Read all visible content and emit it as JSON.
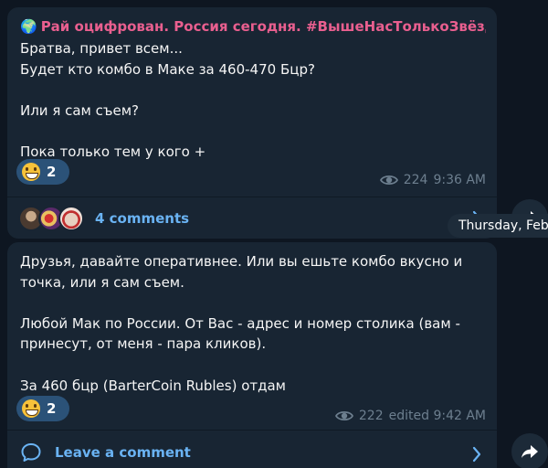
{
  "post1": {
    "channel_emoji": "🌍",
    "channel_name": "Рай оцифрован. Россия сегодня. #ВышеНасТолькоЗвёзд...",
    "text": "Братва, привет всем...\nБудет кто комбо в Маке за 460-470 Бцр?\n\nИли я сам съем?\n\nПока только тем у кого +",
    "reaction_count": "2",
    "views": "224",
    "time": "9:36 AM",
    "comments_label": "4 comments"
  },
  "date_chip": "Thursday, Feb",
  "post2": {
    "text": "Друзья, давайте оперативнее. Или вы ешьте комбо вкусно и точка, или я сам съем.\n\nЛюбой Мак по России. От Вас - адрес и номер столика (вам - принесут, от меня - пара кликов).\n\nЗа 460 бцр (BarterCoin Rubles) отдам",
    "reaction_count": "2",
    "views": "222",
    "time": "edited 9:42 AM",
    "comments_label": "Leave a comment"
  },
  "colors": {
    "background": "#0e1621",
    "bubble": "#182533",
    "channel_name": "#e95f8f",
    "link": "#6ab3f3",
    "meta": "#6d7f8f",
    "reaction_bg": "#2b5278"
  },
  "icons": [
    "globe-emoji",
    "grinning-emoji",
    "eye-icon",
    "comment-bubble-icon",
    "chevron-right-icon",
    "share-arrow-icon"
  ]
}
